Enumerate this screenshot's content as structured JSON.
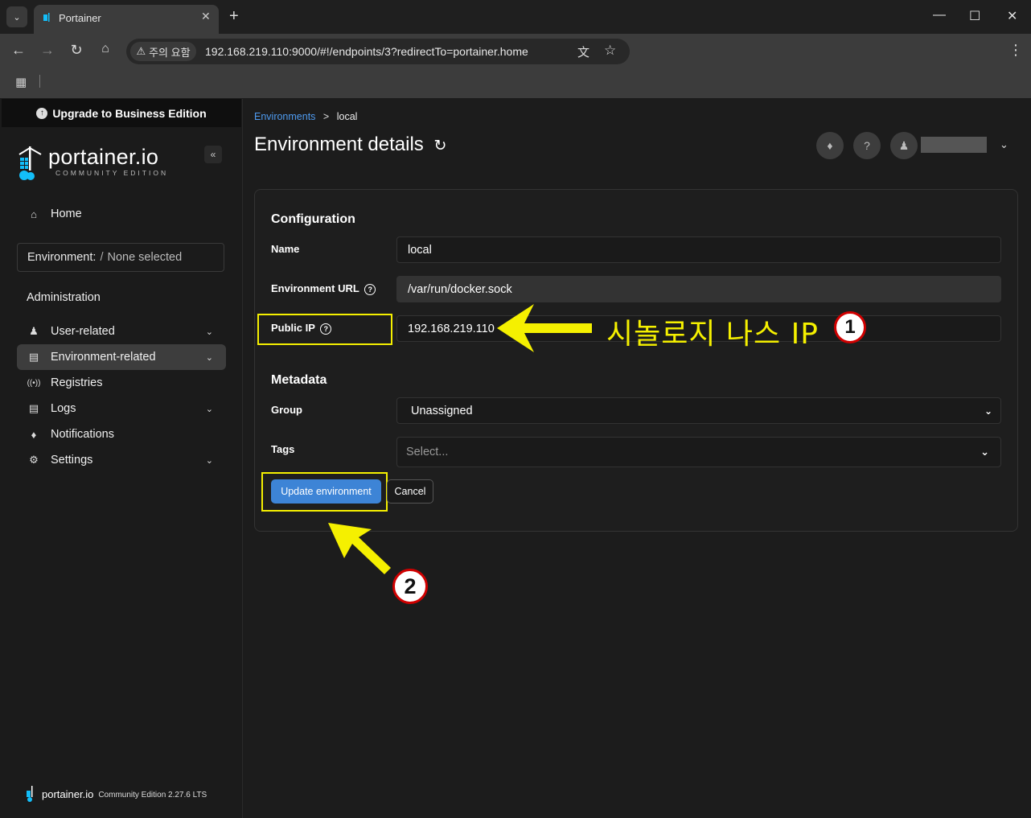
{
  "browser": {
    "tab_title": "Portainer",
    "security_label": "주의 요함",
    "url": "192.168.219.110:9000/#!/endpoints/3?redirectTo=portainer.home"
  },
  "sidebar": {
    "upgrade_label": "Upgrade to Business Edition",
    "logo_text": "portainer.io",
    "logo_subtitle": "COMMUNITY EDITION",
    "home_label": "Home",
    "environment_label": "Environment:",
    "environment_value": "None selected",
    "admin_heading": "Administration",
    "items": [
      {
        "label": "User-related"
      },
      {
        "label": "Environment-related"
      },
      {
        "label": "Registries"
      },
      {
        "label": "Logs"
      },
      {
        "label": "Notifications"
      },
      {
        "label": "Settings"
      }
    ],
    "footer_brand": "portainer.io",
    "footer_version": "Community Edition 2.27.6 LTS"
  },
  "header": {
    "breadcrumb_link": "Environments",
    "breadcrumb_separator": ">",
    "breadcrumb_current": "local",
    "title": "Environment details"
  },
  "form": {
    "configuration_title": "Configuration",
    "name_label": "Name",
    "name_value": "local",
    "url_label": "Environment URL",
    "url_value": "/var/run/docker.sock",
    "public_ip_label": "Public IP",
    "public_ip_value": "192.168.219.110",
    "metadata_title": "Metadata",
    "group_label": "Group",
    "group_value": "Unassigned",
    "tags_label": "Tags",
    "tags_placeholder": "Select...",
    "update_button": "Update environment",
    "cancel_button": "Cancel"
  },
  "annotations": {
    "ip_note": "시놀로지 나스 IP",
    "step1": "1",
    "step2": "2",
    "highlight_color": "#f5f000"
  },
  "colors": {
    "accent": "#3d84d6",
    "link": "#4f9bf0",
    "background": "#1c1c1c"
  }
}
